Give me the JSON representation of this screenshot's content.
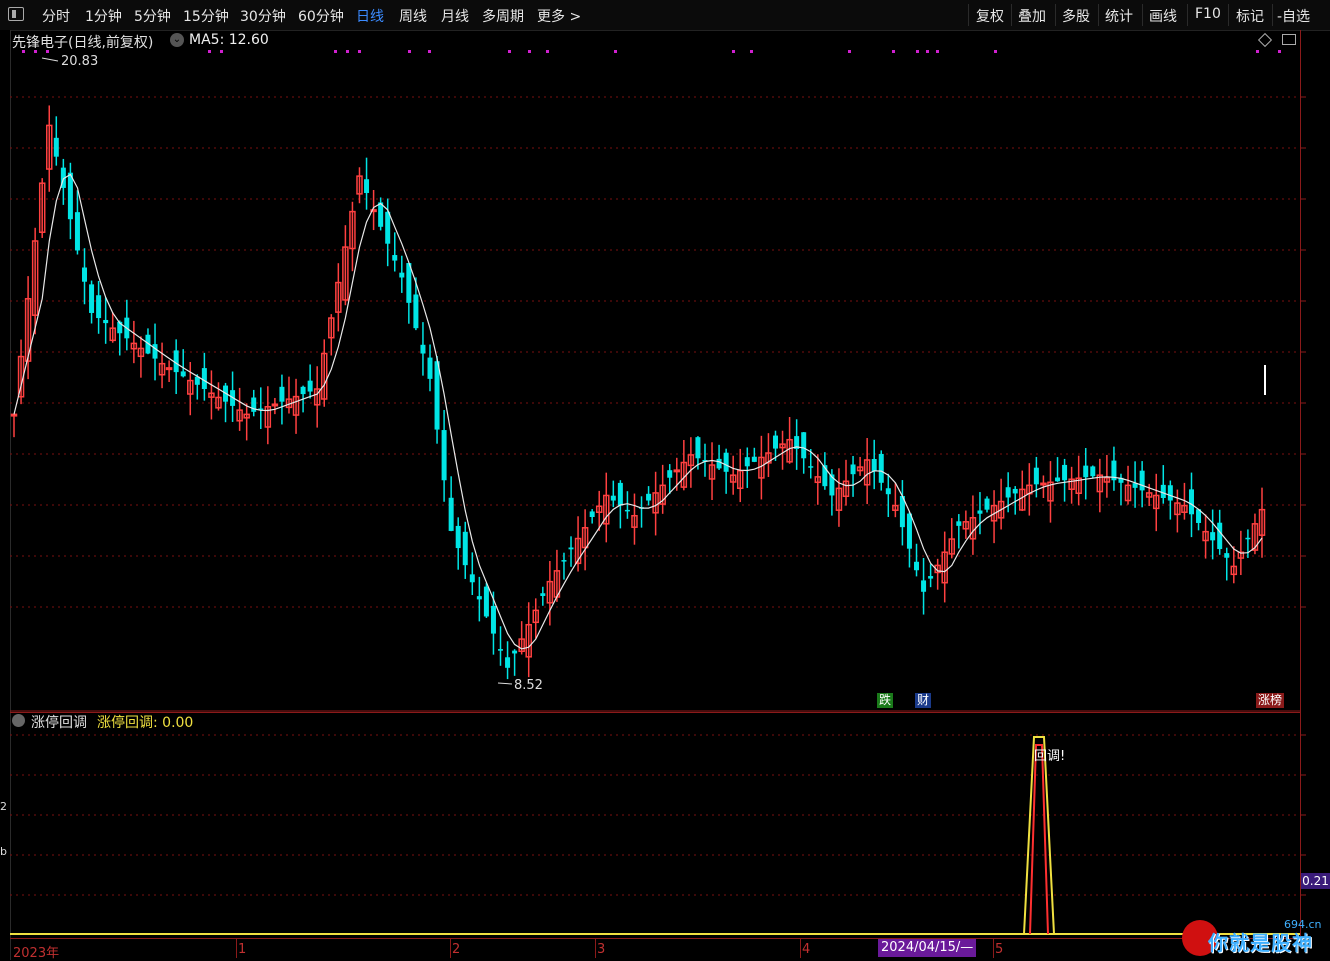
{
  "toolbar": {
    "left_items": [
      "分时",
      "1分钟",
      "5分钟",
      "15分钟",
      "30分钟",
      "60分钟",
      "日线",
      "周线",
      "月线",
      "多周期",
      "更多 >"
    ],
    "active": "日线",
    "right_items": [
      "复权",
      "叠加",
      "多股",
      "统计",
      "画线",
      "F10",
      "标记",
      "-自选"
    ]
  },
  "stock": {
    "title": "先锋电子(日线,前复权)",
    "ma_label": "MA5: 12.60",
    "high_label": "20.83",
    "low_label": "8.52"
  },
  "indicator": {
    "name": "涨停回调",
    "value_label": "涨停回调: 0.00",
    "signal_text": "回调!",
    "right_value": "0.21"
  },
  "badges": {
    "die": "跌",
    "cai": "财",
    "zhangbang": "涨榜"
  },
  "dates": {
    "year": "2023年",
    "m1": "1",
    "m2": "2",
    "m3": "3",
    "m4": "4",
    "highlight": "2024/04/15/—",
    "m5": "5"
  },
  "left_edge": [
    "2",
    "b"
  ],
  "watermark": {
    "text": "你就是股神",
    "url": "694.cn"
  },
  "colors": {
    "up": "#ff4040",
    "down": "#00e5e5",
    "ma": "#e8e8e8",
    "signal": "#f0e040",
    "grid": "#7a1010",
    "magenta": "#d020d0"
  },
  "chart_data": {
    "type": "candlestick",
    "price_range": [
      8.52,
      20.83
    ],
    "ma5_last": 12.6,
    "indicator_series": "涨停回调",
    "indicator_peak_label": "回调!"
  }
}
